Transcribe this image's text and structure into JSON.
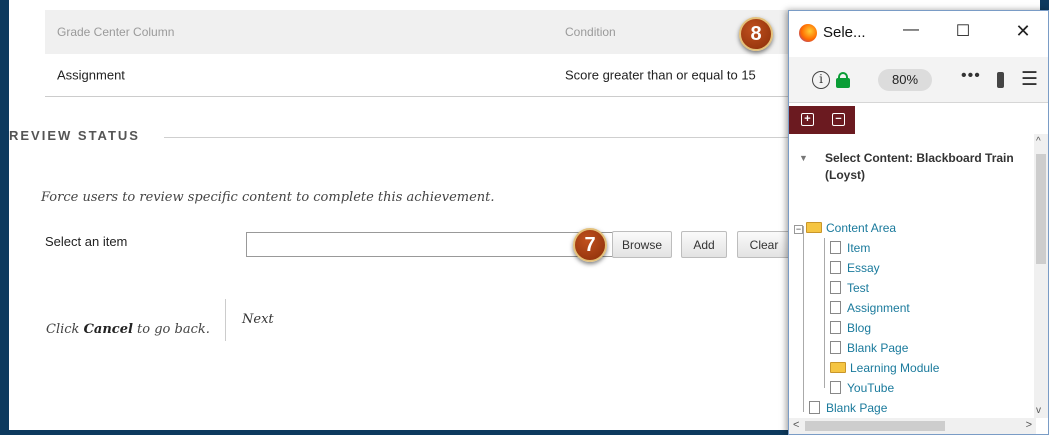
{
  "grid": {
    "header_col1": "Grade Center Column",
    "header_col2": "Condition",
    "row_col1": "Assignment",
    "row_col2": "Score greater than or equal to 15"
  },
  "review": {
    "section_title": "REVIEW STATUS",
    "instruction": "Force users to review specific content to complete this achievement.",
    "field_label": "Select an item",
    "input_value": "",
    "browse_label": "Browse",
    "add_label": "Add",
    "clear_label": "Clear"
  },
  "footer": {
    "cancel_prefix": "Click ",
    "cancel_bold": "Cancel",
    "cancel_suffix": " to go back.",
    "next_label": "Next"
  },
  "markers": {
    "m7": "7",
    "m8": "8"
  },
  "popup": {
    "window_title": "Sele...",
    "minimize_glyph": "—",
    "maximize_glyph": "☐",
    "close_glyph": "✕",
    "info_glyph": "i",
    "zoom": "80%",
    "dots_glyph": "•••",
    "menu_glyph": "☰",
    "tree_root": "Select Content: Blackboard Train (Loyst)",
    "tree_root_arrow": "▼",
    "expand_glyph": "+",
    "collapse_glyph": "−",
    "content_area": "Content Area",
    "items": [
      "Item",
      "Essay",
      "Test",
      "Assignment",
      "Blog",
      "Blank Page",
      "Learning Module",
      "YouTube"
    ],
    "bottom_item": "Blank Page",
    "scroll_up": "^",
    "scroll_down": "v",
    "scroll_left": "<",
    "scroll_right": ">"
  },
  "colors": {
    "frame": "#0d3a5e",
    "link": "#1a7a9c",
    "maroon": "#6b1a20",
    "lock_green": "#0a9d36"
  }
}
